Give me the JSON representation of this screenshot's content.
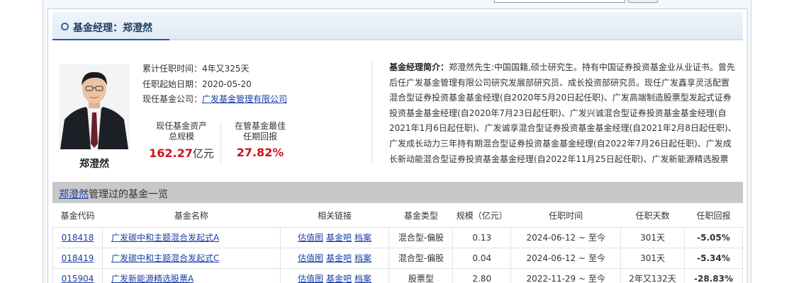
{
  "panel": {
    "title": "基金经理：郑澄然"
  },
  "manager": {
    "name": "郑澄然",
    "tenure_label": "累计任职时间：",
    "tenure_value": "4年又325天",
    "start_label": "任职起始日期：",
    "start_value": "2020-05-20",
    "company_label": "现任基金公司：",
    "company_value": "广发基金管理有限公司"
  },
  "stats": {
    "assets_label_1": "现任基金资产",
    "assets_label_2": "总规模",
    "assets_value": "162.27",
    "assets_unit": "亿元",
    "best_label_1": "在管基金最佳",
    "best_label_2": "任期回报",
    "best_value": "27.82%"
  },
  "bio": {
    "label": "基金经理简介：",
    "text": "郑澄然先生:中国国籍,硕士研究生。持有中国证券投资基金业从业证书。曾先后任广发基金管理有限公司研究发展部研究员、成长投资部研究员。现任广发鑫享灵活配置混合型证券投资基金基金经理(自2020年5月20日起任职)、广发高端制造股票型发起式证券投资基金基金经理(自2020年7月23日起任职)、广发兴诚混合型证券投资基金基金经理(自2021年1月6日起任职)、广发诚享混合型证券投资基金基金经理(自2021年2月8日起任职)、广发成长动力三年持有期混合型证券投资基金基金经理(自2022年7月26日起任职)、广发成长新动能混合型证券投资基金基金经理(自2022年11月25日起任职)、广发新能源精选股票型证券投资"
  },
  "fund_list": {
    "title_link": "郑澄然",
    "title_rest": "管理过的基金一览",
    "columns": [
      "基金代码",
      "基金名称",
      "相关链接",
      "基金类型",
      "规模（亿元）",
      "任职时间",
      "任职天数",
      "任职回报"
    ],
    "link_labels": [
      "估值图",
      "基金吧",
      "档案"
    ],
    "rows": [
      {
        "code": "018418",
        "name": "广发碳中和主题混合发起式A",
        "type": "混合型-偏股",
        "size": "0.13",
        "period": "2024-06-12 ~ 至今",
        "days": "301天",
        "return": "-5.05%"
      },
      {
        "code": "018419",
        "name": "广发碳中和主题混合发起式C",
        "type": "混合型-偏股",
        "size": "0.04",
        "period": "2024-06-12 ~ 至今",
        "days": "301天",
        "return": "-5.34%"
      },
      {
        "code": "015904",
        "name": "广发新能源精选股票A",
        "type": "股票型",
        "size": "2.80",
        "period": "2022-11-29 ~ 至今",
        "days": "2年又132天",
        "return": "-28.83%"
      }
    ]
  },
  "colors": {
    "accent": "#29599a",
    "positive_return": "#d0111b",
    "negative_return": "#0a8a2a",
    "link": "#1a3ea3"
  }
}
